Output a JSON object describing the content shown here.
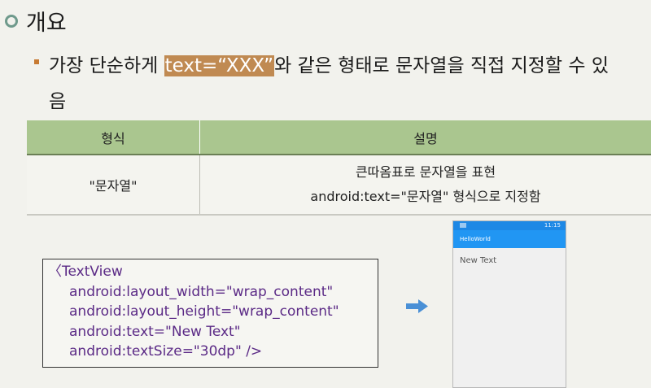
{
  "heading": {
    "title": "개요"
  },
  "bullet": {
    "text_before": "가장 단순하게 ",
    "highlight": "text=“XXX”",
    "text_after": "와 같은 형태로 문자열을 직접 지정할 수 있",
    "text_line2": "음"
  },
  "table": {
    "headers": [
      "형식",
      "설명"
    ],
    "row": {
      "format": "\"문자열\"",
      "description_line1": "큰따옴표로 문자열을 표현",
      "description_line2": "android:text=\"문자열\" 형식으로 지정함"
    }
  },
  "code": {
    "lines": [
      "〈TextView",
      "android:layout_width=\"wrap_content\"",
      "android:layout_height=\"wrap_content\"",
      "android:text=\"New Text\"",
      "android:textSize=\"30dp\" />"
    ]
  },
  "phone": {
    "status_time": "11:15",
    "app_title": "HelloWorld",
    "text_view": "New Text"
  },
  "colors": {
    "accent_ring": "#6f9a8c",
    "bullet": "#c77a32",
    "highlight": "#c08a52",
    "table_header": "#aac68f",
    "code_text": "#5b2a86",
    "arrow": "#4a90d6",
    "app_bar": "#2196f3"
  },
  "icons": {
    "heading": "ring-bullet-icon",
    "arrow": "right-arrow-icon"
  }
}
